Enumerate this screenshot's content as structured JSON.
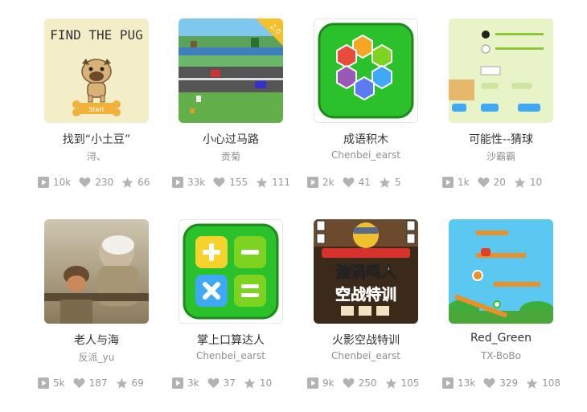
{
  "projects": [
    {
      "title": "找到“小土豆”",
      "author": "浔、",
      "views": "10k",
      "likes": "230",
      "favorites": "66",
      "thumb_text": "FIND THE PUG",
      "thumb_button": "Start"
    },
    {
      "title": "小心过马路",
      "author": "贡菊",
      "views": "33k",
      "likes": "155",
      "favorites": "111",
      "thumb_badge": "2.0"
    },
    {
      "title": "成语积木",
      "author": "Chenbei_earst",
      "views": "2k",
      "likes": "41",
      "favorites": "5"
    },
    {
      "title": "可能性--猜球",
      "author": "沙霸霸",
      "views": "1k",
      "likes": "20",
      "favorites": "10"
    },
    {
      "title": "老人与海",
      "author": "反派_yu",
      "views": "5k",
      "likes": "187",
      "favorites": "69"
    },
    {
      "title": "掌上口算达人",
      "author": "Chenbei_earst",
      "views": "3k",
      "likes": "37",
      "favorites": "10"
    },
    {
      "title": "火影空战特训",
      "author": "Chenbei_earst",
      "views": "9k",
      "likes": "250",
      "favorites": "105",
      "thumb_text": "漩涡鸣人",
      "thumb_subtitle": "空战特训"
    },
    {
      "title": "Red_Green",
      "author": "TX-BoBo",
      "views": "13k",
      "likes": "329",
      "favorites": "108"
    }
  ],
  "colors": {
    "stat_icon": "#b3b3b3",
    "stat_text": "#999999",
    "accent_green": "#2bc12b"
  }
}
